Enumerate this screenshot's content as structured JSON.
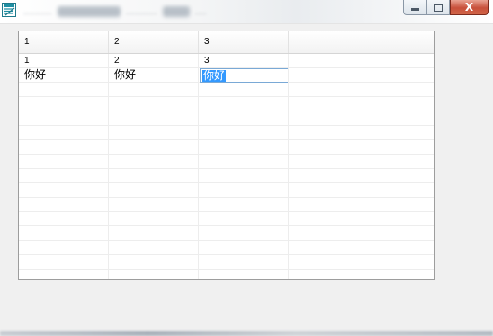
{
  "window": {
    "title_blurred": "• • • • •",
    "title_parts": [
      "..........",
      "................",
      "...........",
      "...",
      "...."
    ],
    "minimize_glyph": "",
    "maximize_glyph": "",
    "close_glyph": "X"
  },
  "grid": {
    "headers": [
      "1",
      "2",
      "3",
      ""
    ],
    "rows": [
      [
        "1",
        "2",
        "3",
        ""
      ],
      [
        "你好",
        "你好",
        "",
        ""
      ]
    ],
    "editing_cell": {
      "selected_text": "你好"
    }
  },
  "colors": {
    "selection": "#3399ff",
    "close_button": "#c8503b",
    "grid_line": "#ededed"
  }
}
